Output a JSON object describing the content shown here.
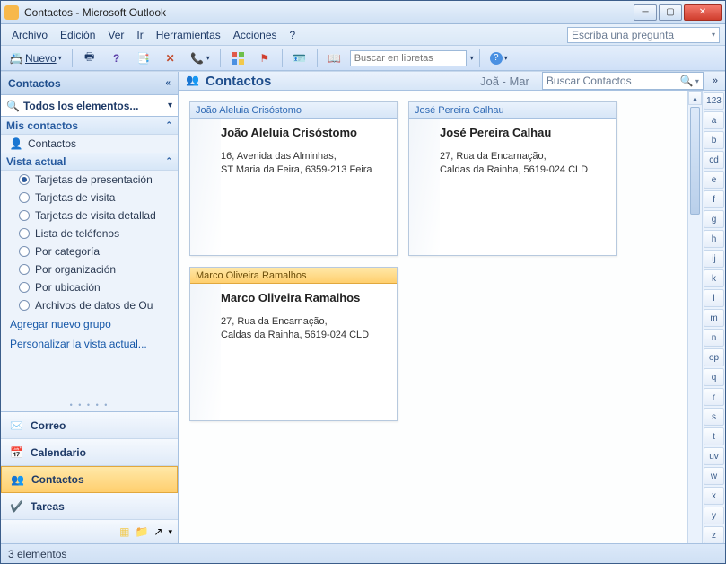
{
  "window": {
    "title": "Contactos - Microsoft Outlook"
  },
  "menu": {
    "archivo": "Archivo",
    "edicion": "Edición",
    "ver": "Ver",
    "ir": "Ir",
    "herramientas": "Herramientas",
    "acciones": "Acciones",
    "ayuda": "?",
    "askbox_placeholder": "Escriba una pregunta"
  },
  "toolbar": {
    "nuevo": "Nuevo",
    "buscar_placeholder": "Buscar en libretas"
  },
  "nav": {
    "title": "Contactos",
    "scope": "Todos los elementos...",
    "mis_contactos": "Mis contactos",
    "contactos_item": "Contactos",
    "vista_actual": "Vista actual",
    "radios": [
      "Tarjetas de presentación",
      "Tarjetas de visita",
      "Tarjetas de visita detallad",
      "Lista de teléfonos",
      "Por categoría",
      "Por organización",
      "Por ubicación",
      "Archivos de datos de Ou"
    ],
    "add_group": "Agregar nuevo grupo",
    "customize_view": "Personalizar la vista actual...",
    "footer": {
      "correo": "Correo",
      "calendario": "Calendario",
      "contactos": "Contactos",
      "tareas": "Tareas"
    }
  },
  "main": {
    "title": "Contactos",
    "range": "Joã - Mar",
    "search_placeholder": "Buscar Contactos"
  },
  "contacts": [
    {
      "header": "João Aleluia Crisóstomo",
      "name": "João Aleluia Crisóstomo",
      "addr1": "16, Avenida das Alminhas,",
      "addr2": "ST Maria da Feira,  6359-213 Feira",
      "selected": false
    },
    {
      "header": "José Pereira Calhau",
      "name": "José Pereira Calhau",
      "addr1": "27, Rua da Encarnação,",
      "addr2": "Caldas da Rainha, 5619-024 CLD",
      "selected": false
    },
    {
      "header": "Marco Oliveira Ramalhos",
      "name": "Marco Oliveira Ramalhos",
      "addr1": "27, Rua da Encarnação,",
      "addr2": "Caldas da Rainha, 5619-024 CLD",
      "selected": true
    }
  ],
  "index": [
    "123",
    "a",
    "b",
    "cd",
    "e",
    "f",
    "g",
    "h",
    "ij",
    "k",
    "l",
    "m",
    "n",
    "op",
    "q",
    "r",
    "s",
    "t",
    "uv",
    "w",
    "x",
    "y",
    "z",
    ""
  ],
  "status": "3 elementos"
}
